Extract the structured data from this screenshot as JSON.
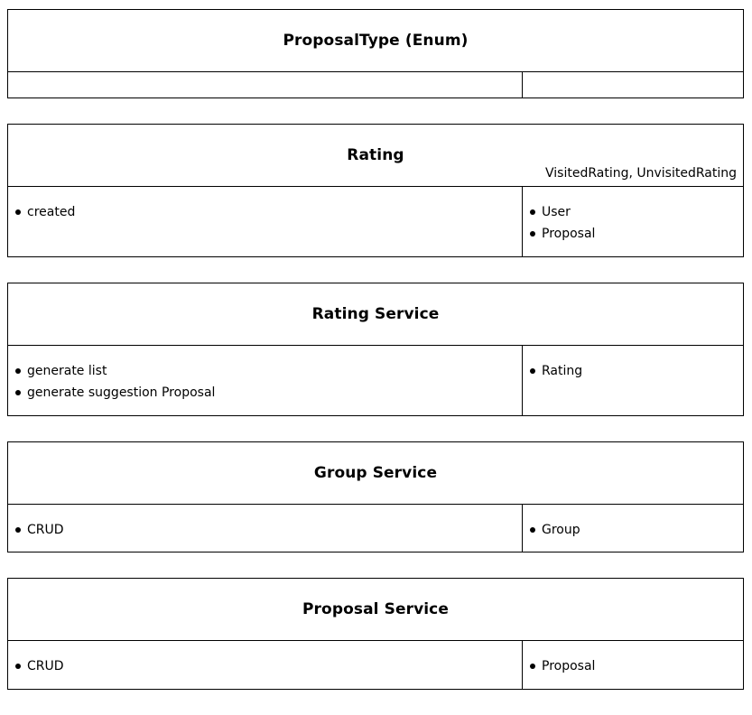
{
  "cards": [
    {
      "title": "ProposalType (Enum)",
      "subtitle": "",
      "left_items": [],
      "right_items": []
    },
    {
      "title": "Rating",
      "subtitle": "VisitedRating, UnvisitedRating",
      "left_items": [
        "created"
      ],
      "right_items": [
        "User",
        "Proposal"
      ]
    },
    {
      "title": "Rating Service",
      "subtitle": "",
      "left_items": [
        "generate list",
        "generate suggestion Proposal"
      ],
      "right_items": [
        "Rating"
      ]
    },
    {
      "title": "Group Service",
      "subtitle": "",
      "left_items": [
        "CRUD"
      ],
      "right_items": [
        "Group"
      ]
    },
    {
      "title": "Proposal Service",
      "subtitle": "",
      "left_items": [
        "CRUD"
      ],
      "right_items": [
        "Proposal"
      ]
    }
  ]
}
